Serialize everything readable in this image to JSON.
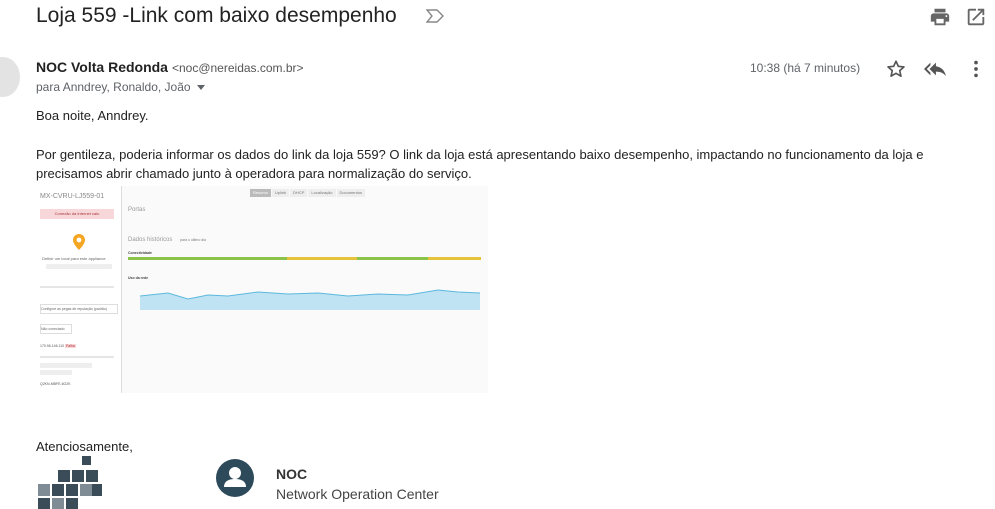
{
  "email": {
    "subject": "Loja 559 -Link com baixo desempenho",
    "sender_name": "NOC Volta Redonda",
    "sender_email": "<noc@nereidas.com.br>",
    "recipients": "para Anndrey, Ronaldo, João",
    "time": "10:38 (há 7 minutos)",
    "greeting": "Boa noite, Anndrey.",
    "body_line1": "Por gentileza, poderia informar os dados do link  da loja 559? O link da loja está apresentando baixo desempenho, impactando no funcionamento da loja e",
    "body_line2": "precisamos abrir chamado junto à operadora para normalização do serviço.",
    "closing": "Atenciosamente,"
  },
  "screenshot": {
    "device_name": "MX-CVRU-LJ559-01",
    "alert": "Conexão da Internet caiu",
    "map_caption": "Definir um local para este appliance",
    "tabs": [
      "Resumo",
      "Uplink",
      "DHCP",
      "Localização",
      "Documentos"
    ],
    "ports_label": "Portas",
    "history_label": "Dados históricos",
    "history_range": "para o último dia",
    "connectivity_label": "Conectividade",
    "usage_label": "Uso da rede",
    "config_label": "Configure as pegas de reputação (padrão)",
    "status_text": "Não conectado",
    "wan_ip": "170.96.146.110",
    "wan_badge": "Falha",
    "serial": "Q2KN-MBFE-6G2K"
  },
  "signature": {
    "title": "NOC",
    "subtitle": "Network Operation Center"
  },
  "colors": {
    "connectivity_green": "#8bc34a",
    "connectivity_yellow": "#e6c13a",
    "usage_fill": "#bfe3f2",
    "usage_line": "#5cb8de",
    "alert_bg": "#f8d7da",
    "badge_bg": "#2d4a5a"
  },
  "icons": [
    "label-importance-icon",
    "print-icon",
    "open-in-new-window-icon",
    "star-icon",
    "reply-all-icon",
    "more-vert-icon",
    "chevron-down-icon",
    "map-pin-icon",
    "person-icon"
  ]
}
